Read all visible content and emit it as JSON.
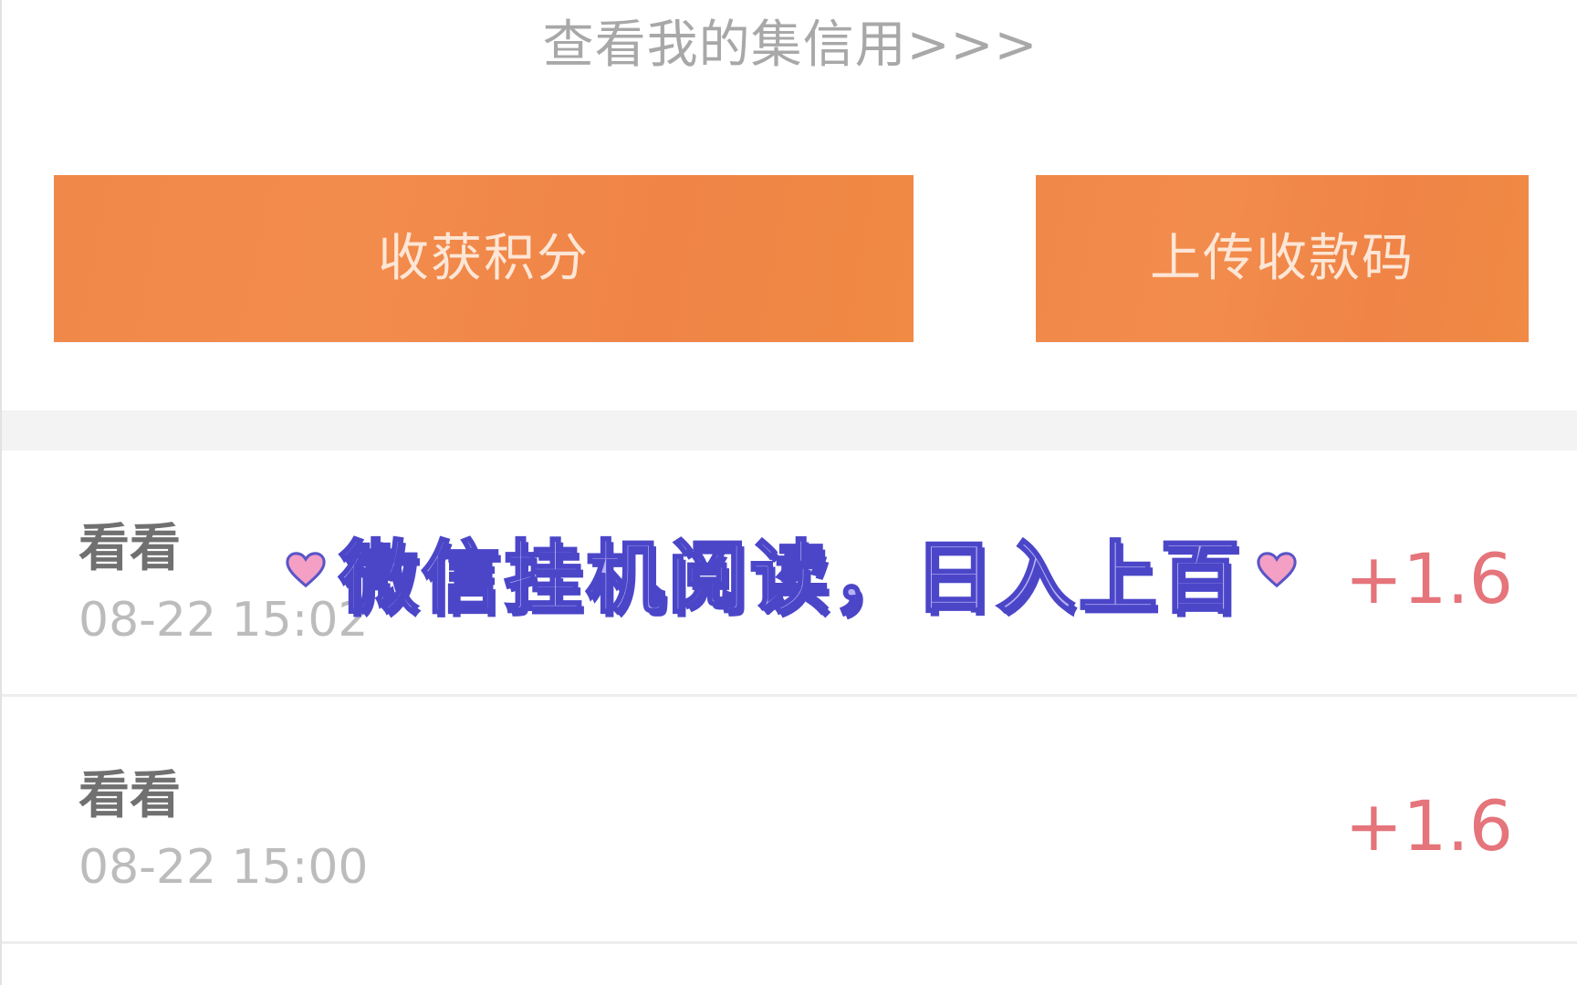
{
  "header": {
    "credit_link": "查看我的集信用>>>"
  },
  "actions": {
    "collect_points": "收获积分",
    "upload_code": "上传收款码"
  },
  "records": [
    {
      "title": "看看",
      "time": "08-22 15:02",
      "amount": "+1.6"
    },
    {
      "title": "看看",
      "time": "08-22 15:00",
      "amount": "+1.6"
    }
  ],
  "overlay": {
    "caption": "微信挂机阅读，日入上百"
  },
  "colors": {
    "button": "#f0884a",
    "amount": "#e5747b",
    "caption_fill": "#b8b2f4",
    "caption_stroke": "#4b46c8",
    "heart": "#f4a0c4"
  }
}
